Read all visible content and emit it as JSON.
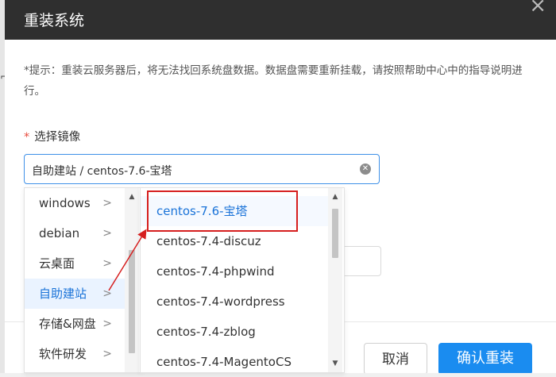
{
  "dialog": {
    "title": "重装系统",
    "close_glyph": "×",
    "tip": "*提示：重装云服务器后，将无法找回系统盘数据。数据盘需要重新挂载，请按照帮助中心中的指导说明进行。"
  },
  "form": {
    "image_label": "选择镜像",
    "required_mark": "*",
    "selected_value": "自助建站 / centos-7.6-宝塔",
    "clear_glyph": "✕"
  },
  "cascader": {
    "categories": [
      {
        "label": "windows",
        "active": false
      },
      {
        "label": "debian",
        "active": false
      },
      {
        "label": "云桌面",
        "active": false
      },
      {
        "label": "自助建站",
        "active": true
      },
      {
        "label": "存储&网盘",
        "active": false
      },
      {
        "label": "软件研发",
        "active": false
      }
    ],
    "images": [
      {
        "label": "centos-7.6-宝塔",
        "active": true
      },
      {
        "label": "centos-7.4-discuz",
        "active": false
      },
      {
        "label": "centos-7.4-phpwind",
        "active": false
      },
      {
        "label": "centos-7.4-wordpress",
        "active": false
      },
      {
        "label": "centos-7.4-zblog",
        "active": false
      },
      {
        "label": "centos-7.4-MagentoCS",
        "active": false
      }
    ],
    "chevron_glyph": ">",
    "scroll_up_glyph": "▲",
    "scroll_down_glyph": "▼"
  },
  "buttons": {
    "cancel": "取消",
    "confirm": "确认重装"
  },
  "colors": {
    "header_bg": "#2f2f2f",
    "accent": "#1a8cf0",
    "active_text": "#1a73d8",
    "annotation": "#d61f1f",
    "required": "#e84a3c"
  }
}
